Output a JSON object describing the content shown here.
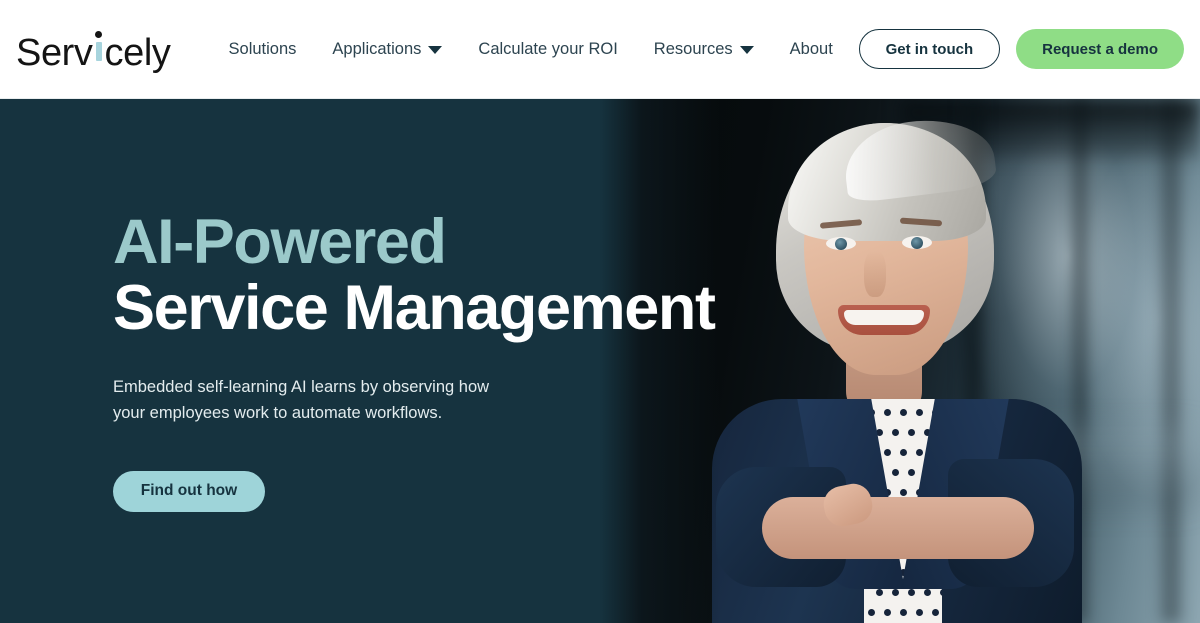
{
  "header": {
    "logo": {
      "text": "Servicely",
      "part_before_i": "Serv",
      "part_after_i": "cely",
      "accent_color": "#a7d4dd"
    },
    "nav": [
      {
        "label": "Solutions",
        "has_dropdown": false,
        "icon": ""
      },
      {
        "label": "Applications",
        "has_dropdown": true,
        "icon": "chevron-down-icon"
      },
      {
        "label": "Calculate your ROI",
        "has_dropdown": false,
        "icon": ""
      },
      {
        "label": "Resources",
        "has_dropdown": true,
        "icon": "chevron-down-icon"
      },
      {
        "label": "About",
        "has_dropdown": false,
        "icon": ""
      }
    ],
    "get_in_touch_label": "Get in touch",
    "request_demo_label": "Request a demo",
    "background": "#ffffff",
    "text_color": "#2d4450"
  },
  "hero": {
    "heading_line1": "AI-Powered",
    "heading_line2": "Service Management",
    "heading_line1_color": "#9bc9ca",
    "heading_line2_color": "#ffffff",
    "subtext": "Embedded self-learning AI learns by observing how your employees work to automate workflows.",
    "cta_label": "Find out how",
    "cta_color": "#9ed4d9",
    "background": "#16333f",
    "image_alt": "Smiling businesswoman with short silver hair wearing a navy blazer over a white polka dot blouse, arms crossed, standing in a blurred modern office"
  },
  "colors": {
    "brand_dark": "#16333f",
    "brand_teal": "#9ed4d9",
    "brand_green": "#8fdd86",
    "heading_teal": "#9bc9ca"
  }
}
